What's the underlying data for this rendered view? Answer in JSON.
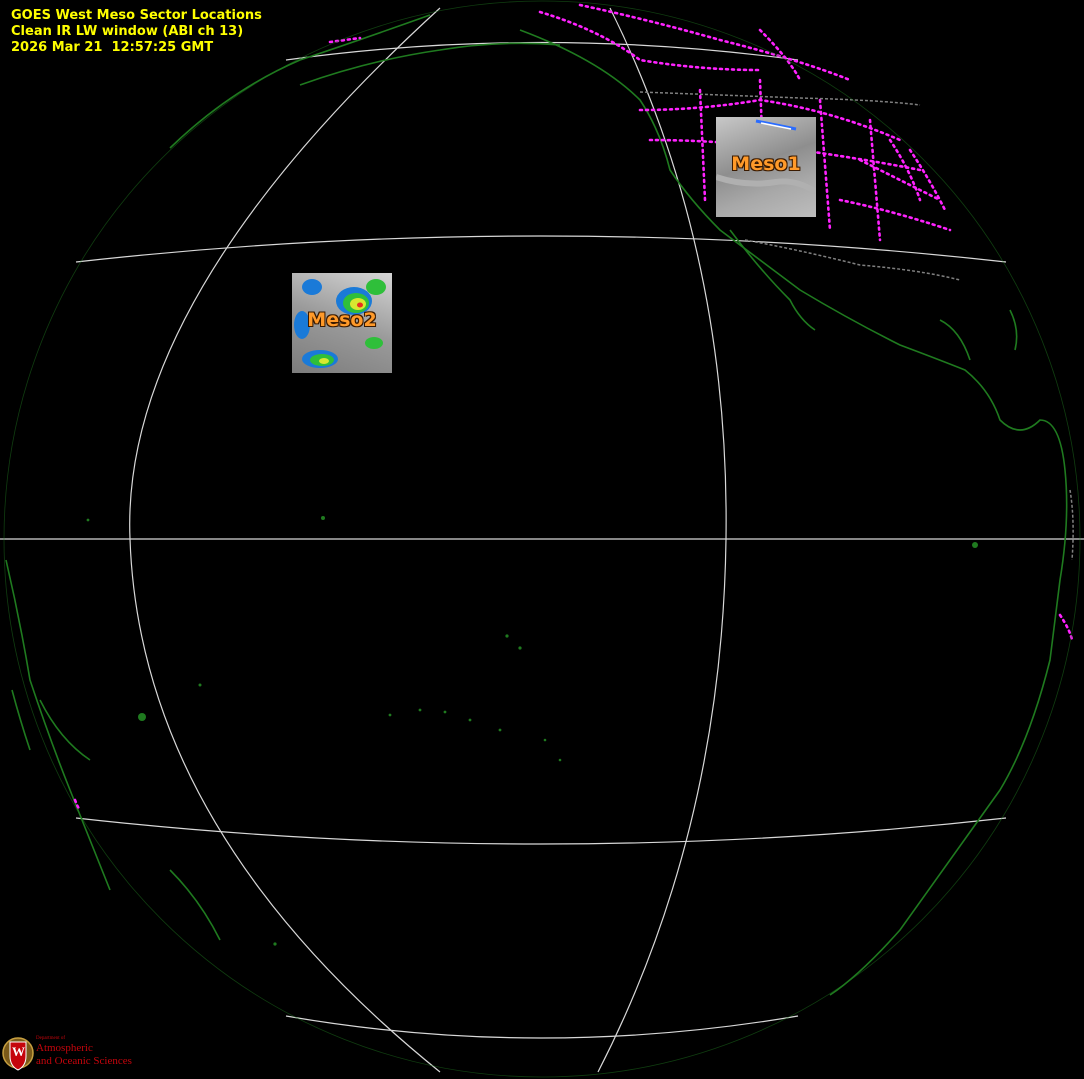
{
  "header": {
    "line1": "GOES West Meso Sector Locations",
    "line2": "Clean IR LW window (ABI ch 13)",
    "line3": "2026 Mar 21  12:57:25 GMT"
  },
  "sectors": {
    "meso1": {
      "label": "Meso1"
    },
    "meso2": {
      "label": "Meso2"
    }
  },
  "colors": {
    "background": "#000000",
    "title": "#ffff00",
    "coastline": "#1f7a1f",
    "state_borders": "#ff22ff",
    "country_borders": "#808080",
    "graticule": "#d8d8d8",
    "sector_label": "#ff9a2a"
  },
  "logo": {
    "small": "Department of",
    "line1": "Atmospheric",
    "line2": "and Oceanic Sciences",
    "shield_letter": "W"
  }
}
